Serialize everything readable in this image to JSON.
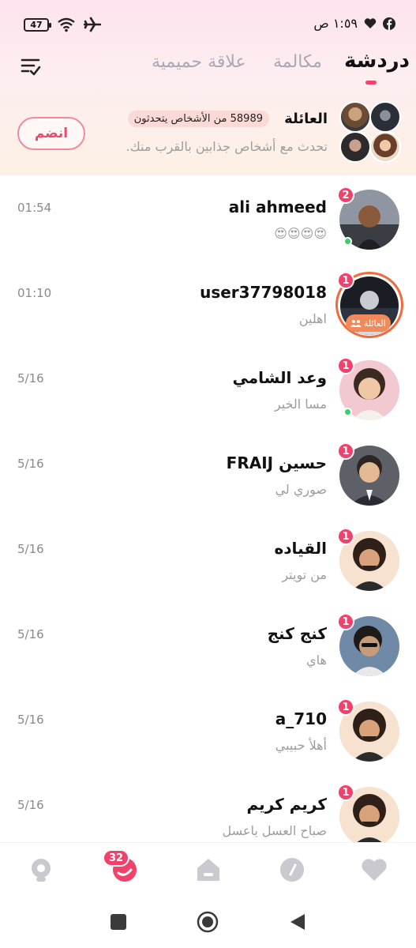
{
  "status_bar": {
    "battery": "47",
    "time": "١:٥٩ ص",
    "icons": [
      "battery-icon",
      "wifi-icon",
      "airplane-icon",
      "heart-icon",
      "facebook-icon"
    ]
  },
  "header": {
    "tabs": [
      {
        "label": "دردشة",
        "active": true
      },
      {
        "label": "مكالمة",
        "active": false
      },
      {
        "label": "علاقة حميمية",
        "active": false
      }
    ],
    "accent": "#f0426a"
  },
  "family_banner": {
    "title": "العائلة",
    "count_text": "58989 من الأشخاص يتحدثون",
    "subtitle": "تحدث مع أشخاص جذابين بالقرب منك.",
    "join_label": "انضم"
  },
  "chats": [
    {
      "name": "ali ahmeed",
      "message": "😍😍😍😍",
      "time": "01:54",
      "unread": "2",
      "online": true
    },
    {
      "name": "user37798018",
      "message": "اهلين",
      "time": "01:10",
      "unread": "1",
      "online": false,
      "family_tag": "العائلة"
    },
    {
      "name": "وعد الشامي",
      "message": "مسا الخير",
      "time": "5/16",
      "unread": "1",
      "online": true
    },
    {
      "name": "حسين FRAIJ",
      "message": "صوري لي",
      "time": "5/16",
      "unread": "1",
      "online": false
    },
    {
      "name": "القياده",
      "message": "من تويتر",
      "time": "5/16",
      "unread": "1",
      "online": false
    },
    {
      "name": "كنج كنج",
      "message": "هاي",
      "time": "5/16",
      "unread": "1",
      "online": false
    },
    {
      "name": "a_710",
      "message": "أهلأ حبيبي",
      "time": "5/16",
      "unread": "1",
      "online": false
    },
    {
      "name": "كريم كريم",
      "message": "صباح العسل ياعسل",
      "time": "5/16",
      "unread": "1",
      "online": false
    }
  ],
  "bottom_nav": {
    "badge": "32",
    "items": [
      "planet-icon",
      "chat-icon",
      "home-icon",
      "compass-icon",
      "heart-icon"
    ]
  }
}
